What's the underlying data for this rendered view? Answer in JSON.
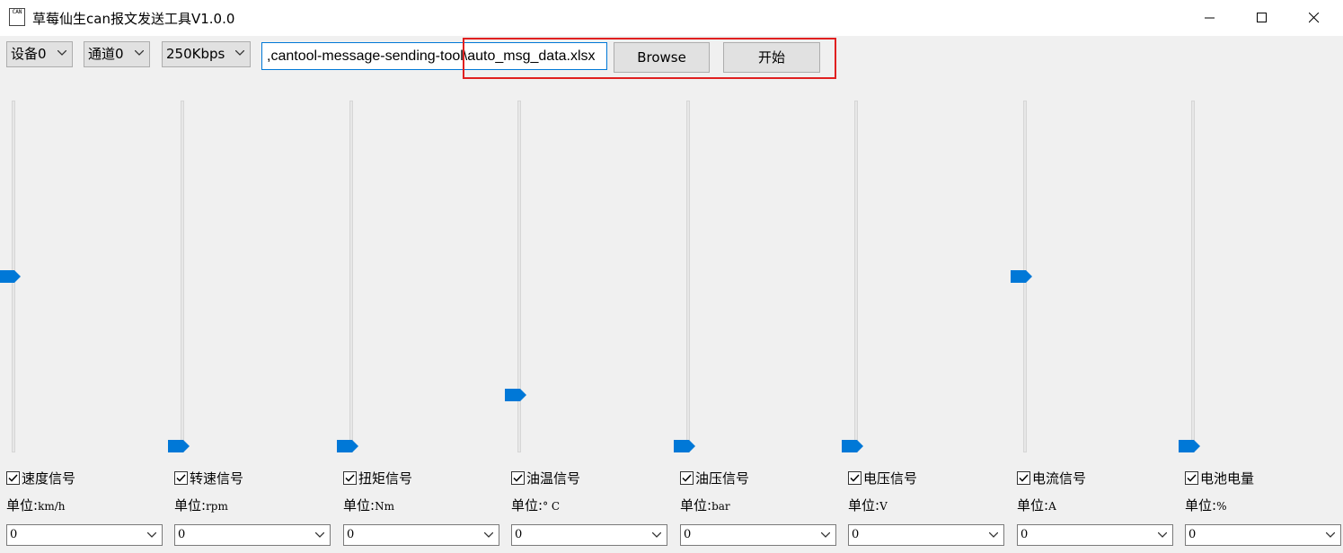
{
  "window": {
    "title": "草莓仙生can报文发送工具V1.0.0",
    "app_icon_text": "CAN"
  },
  "toolbar": {
    "device": "设备0",
    "channel": "通道0",
    "baudrate": "250Kbps",
    "file_path": ",cantool-message-sending-tool\\auto_msg_data.xlsx",
    "browse_label": "Browse",
    "start_label": "开始"
  },
  "signals": [
    {
      "name": "速度信号",
      "unit_label": "单位:",
      "unit": "km/h",
      "value": "0",
      "slider_level": 0.5,
      "checked": true
    },
    {
      "name": "转速信号",
      "unit_label": "单位:",
      "unit": "rpm",
      "value": "0",
      "slider_level": 0.0,
      "checked": true
    },
    {
      "name": "扭矩信号",
      "unit_label": "单位:",
      "unit": "Nm",
      "value": "0",
      "slider_level": 0.0,
      "checked": true
    },
    {
      "name": "油温信号",
      "unit_label": "单位:",
      "unit": "° C",
      "value": "0",
      "slider_level": 0.15,
      "checked": true
    },
    {
      "name": "油压信号",
      "unit_label": "单位:",
      "unit": "bar",
      "value": "0",
      "slider_level": 0.0,
      "checked": true
    },
    {
      "name": "电压信号",
      "unit_label": "单位:",
      "unit": "V",
      "value": "0",
      "slider_level": 0.0,
      "checked": true
    },
    {
      "name": "电流信号",
      "unit_label": "单位:",
      "unit": "A",
      "value": "0",
      "slider_level": 0.5,
      "checked": true
    },
    {
      "name": "电池电量",
      "unit_label": "单位:",
      "unit": "%",
      "value": "0",
      "slider_level": 0.0,
      "checked": true
    }
  ],
  "colors": {
    "accent": "#0078d7",
    "highlight": "#e02020"
  }
}
